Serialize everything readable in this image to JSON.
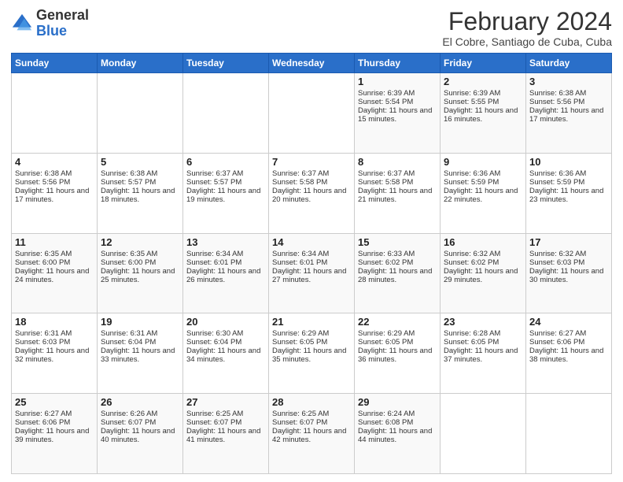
{
  "header": {
    "logo_general": "General",
    "logo_blue": "Blue",
    "month_title": "February 2024",
    "location": "El Cobre, Santiago de Cuba, Cuba"
  },
  "days_of_week": [
    "Sunday",
    "Monday",
    "Tuesday",
    "Wednesday",
    "Thursday",
    "Friday",
    "Saturday"
  ],
  "weeks": [
    [
      {
        "day": "",
        "info": ""
      },
      {
        "day": "",
        "info": ""
      },
      {
        "day": "",
        "info": ""
      },
      {
        "day": "",
        "info": ""
      },
      {
        "day": "1",
        "info": "Sunrise: 6:39 AM\nSunset: 5:54 PM\nDaylight: 11 hours and 15 minutes."
      },
      {
        "day": "2",
        "info": "Sunrise: 6:39 AM\nSunset: 5:55 PM\nDaylight: 11 hours and 16 minutes."
      },
      {
        "day": "3",
        "info": "Sunrise: 6:38 AM\nSunset: 5:56 PM\nDaylight: 11 hours and 17 minutes."
      }
    ],
    [
      {
        "day": "4",
        "info": "Sunrise: 6:38 AM\nSunset: 5:56 PM\nDaylight: 11 hours and 17 minutes."
      },
      {
        "day": "5",
        "info": "Sunrise: 6:38 AM\nSunset: 5:57 PM\nDaylight: 11 hours and 18 minutes."
      },
      {
        "day": "6",
        "info": "Sunrise: 6:37 AM\nSunset: 5:57 PM\nDaylight: 11 hours and 19 minutes."
      },
      {
        "day": "7",
        "info": "Sunrise: 6:37 AM\nSunset: 5:58 PM\nDaylight: 11 hours and 20 minutes."
      },
      {
        "day": "8",
        "info": "Sunrise: 6:37 AM\nSunset: 5:58 PM\nDaylight: 11 hours and 21 minutes."
      },
      {
        "day": "9",
        "info": "Sunrise: 6:36 AM\nSunset: 5:59 PM\nDaylight: 11 hours and 22 minutes."
      },
      {
        "day": "10",
        "info": "Sunrise: 6:36 AM\nSunset: 5:59 PM\nDaylight: 11 hours and 23 minutes."
      }
    ],
    [
      {
        "day": "11",
        "info": "Sunrise: 6:35 AM\nSunset: 6:00 PM\nDaylight: 11 hours and 24 minutes."
      },
      {
        "day": "12",
        "info": "Sunrise: 6:35 AM\nSunset: 6:00 PM\nDaylight: 11 hours and 25 minutes."
      },
      {
        "day": "13",
        "info": "Sunrise: 6:34 AM\nSunset: 6:01 PM\nDaylight: 11 hours and 26 minutes."
      },
      {
        "day": "14",
        "info": "Sunrise: 6:34 AM\nSunset: 6:01 PM\nDaylight: 11 hours and 27 minutes."
      },
      {
        "day": "15",
        "info": "Sunrise: 6:33 AM\nSunset: 6:02 PM\nDaylight: 11 hours and 28 minutes."
      },
      {
        "day": "16",
        "info": "Sunrise: 6:32 AM\nSunset: 6:02 PM\nDaylight: 11 hours and 29 minutes."
      },
      {
        "day": "17",
        "info": "Sunrise: 6:32 AM\nSunset: 6:03 PM\nDaylight: 11 hours and 30 minutes."
      }
    ],
    [
      {
        "day": "18",
        "info": "Sunrise: 6:31 AM\nSunset: 6:03 PM\nDaylight: 11 hours and 32 minutes."
      },
      {
        "day": "19",
        "info": "Sunrise: 6:31 AM\nSunset: 6:04 PM\nDaylight: 11 hours and 33 minutes."
      },
      {
        "day": "20",
        "info": "Sunrise: 6:30 AM\nSunset: 6:04 PM\nDaylight: 11 hours and 34 minutes."
      },
      {
        "day": "21",
        "info": "Sunrise: 6:29 AM\nSunset: 6:05 PM\nDaylight: 11 hours and 35 minutes."
      },
      {
        "day": "22",
        "info": "Sunrise: 6:29 AM\nSunset: 6:05 PM\nDaylight: 11 hours and 36 minutes."
      },
      {
        "day": "23",
        "info": "Sunrise: 6:28 AM\nSunset: 6:05 PM\nDaylight: 11 hours and 37 minutes."
      },
      {
        "day": "24",
        "info": "Sunrise: 6:27 AM\nSunset: 6:06 PM\nDaylight: 11 hours and 38 minutes."
      }
    ],
    [
      {
        "day": "25",
        "info": "Sunrise: 6:27 AM\nSunset: 6:06 PM\nDaylight: 11 hours and 39 minutes."
      },
      {
        "day": "26",
        "info": "Sunrise: 6:26 AM\nSunset: 6:07 PM\nDaylight: 11 hours and 40 minutes."
      },
      {
        "day": "27",
        "info": "Sunrise: 6:25 AM\nSunset: 6:07 PM\nDaylight: 11 hours and 41 minutes."
      },
      {
        "day": "28",
        "info": "Sunrise: 6:25 AM\nSunset: 6:07 PM\nDaylight: 11 hours and 42 minutes."
      },
      {
        "day": "29",
        "info": "Sunrise: 6:24 AM\nSunset: 6:08 PM\nDaylight: 11 hours and 44 minutes."
      },
      {
        "day": "",
        "info": ""
      },
      {
        "day": "",
        "info": ""
      }
    ]
  ]
}
